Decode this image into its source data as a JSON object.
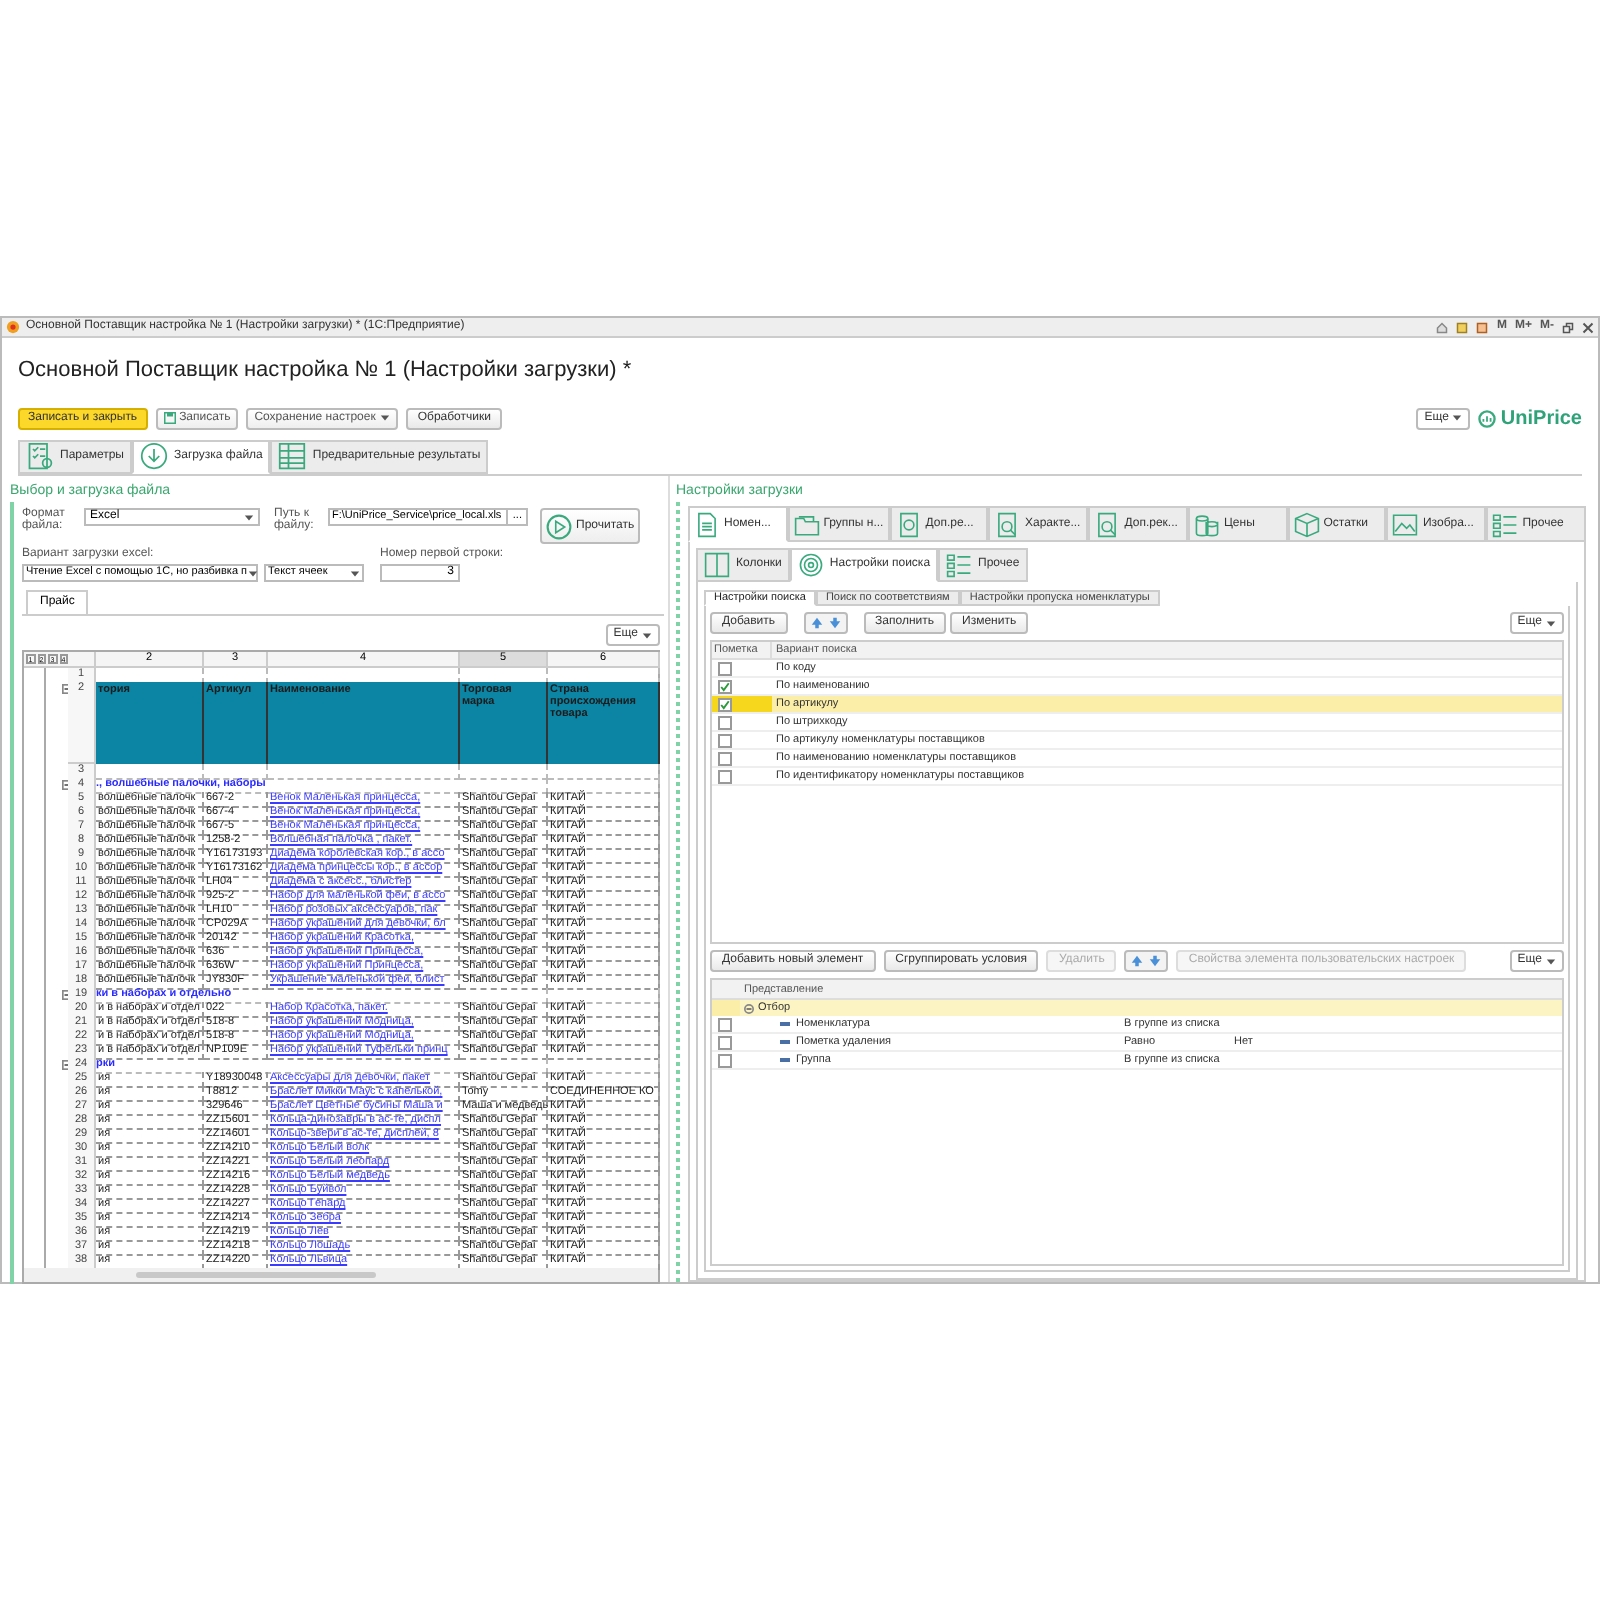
{
  "window": {
    "title": "Основной Поставщик настройка № 1 (Настройки загрузки) * (1С:Предприятие)",
    "memory_buttons": [
      "M",
      "M+",
      "M-"
    ]
  },
  "form": {
    "title": "Основной Поставщик настройка № 1 (Настройки загрузки) *"
  },
  "toolbar": {
    "buttons": [
      {
        "label": "Записать и закрыть",
        "kind": "primary"
      },
      {
        "label": "Записать",
        "kind": "save"
      },
      {
        "label": "Сохранение настроек",
        "kind": "dropdown"
      },
      {
        "label": "Обработчики",
        "kind": "plain"
      }
    ],
    "more": "Еще",
    "logo": "UniPrice"
  },
  "main_tabs": [
    {
      "label": "Параметры",
      "selected": false
    },
    {
      "label": "Загрузка файла",
      "selected": true
    },
    {
      "label": "Предварительные результаты",
      "selected": false
    }
  ],
  "left": {
    "title": "Выбор и загрузка файла",
    "format_label": "Формат файла:",
    "format_value": "Excel",
    "path_label": "Путь к файлу:",
    "path_value": "F:\\UniPrice_Service\\price_local.xls",
    "path_button": "...",
    "read_button": "Прочитать",
    "variant_label": "Вариант загрузки excel:",
    "variant_value": "Чтение Excel с помощью 1С, но разбивка п",
    "text_mode": "Текст ячеек",
    "first_row_label": "Номер первой строки:",
    "first_row_value": "3",
    "sheet_tab": "Прайс",
    "more": "Еще",
    "levels": [
      "1",
      "2",
      "3",
      "4"
    ],
    "columns": [
      {
        "label": "2",
        "selected": false
      },
      {
        "label": "3",
        "selected": false
      },
      {
        "label": "4",
        "selected": false
      },
      {
        "label": "5",
        "selected": true
      },
      {
        "label": "6",
        "selected": false
      }
    ],
    "rows": [
      {
        "n": "1",
        "kind": "empty",
        "cells": []
      },
      {
        "n": "2",
        "kind": "header",
        "cells": [
          "тория",
          "Артикул",
          "Наименование",
          "Торговая марка",
          "Страна происхождения товара"
        ]
      },
      {
        "n": "3",
        "kind": "empty",
        "cells": []
      },
      {
        "n": "4",
        "kind": "group",
        "cells": [
          "., волшебные палочки, наборы"
        ]
      },
      {
        "n": "5",
        "kind": "data",
        "cells": [
          "волшебные палочк",
          "667-2",
          "Венок Маленькая принцесса,",
          "Shantou Gepai",
          "КИТАЙ"
        ]
      },
      {
        "n": "6",
        "kind": "data",
        "cells": [
          "волшебные палочк",
          "667-4",
          "Венок Маленькая принцесса,",
          "Shantou Gepai",
          "КИТАЙ"
        ]
      },
      {
        "n": "7",
        "kind": "data",
        "cells": [
          "волшебные палочк",
          "667-5",
          "Венок Маленькая принцесса,",
          "Shantou Gepai",
          "КИТАЙ"
        ]
      },
      {
        "n": "8",
        "kind": "data",
        "cells": [
          "волшебные палочк",
          "1258-2",
          "Волшебная палочка , пакет.",
          "Shantou Gepai",
          "КИТАЙ"
        ]
      },
      {
        "n": "9",
        "kind": "data",
        "cells": [
          "волшебные палочк",
          "Y16173193",
          "Диадема королевская кор., в ассо",
          "Shantou Gepai",
          "КИТАЙ"
        ]
      },
      {
        "n": "10",
        "kind": "data",
        "cells": [
          "волшебные палочк",
          "Y16173162",
          "Диадема принцессы кор., в ассор",
          "Shantou Gepai",
          "КИТАЙ"
        ]
      },
      {
        "n": "11",
        "kind": "data",
        "cells": [
          "волшебные палочк",
          "LH04",
          "Диадема с аксесс., блистер",
          "Shantou Gepai",
          "КИТАЙ"
        ]
      },
      {
        "n": "12",
        "kind": "data",
        "cells": [
          "волшебные палочк",
          "925-2",
          "Набор для маленькой феи, в ассо",
          "Shantou Gepai",
          "КИТАЙ"
        ]
      },
      {
        "n": "13",
        "kind": "data",
        "cells": [
          "волшебные палочк",
          "LH10",
          "Набор розовых аксессуаров, пак",
          "Shantou Gepai",
          "КИТАЙ"
        ]
      },
      {
        "n": "14",
        "kind": "data",
        "cells": [
          "волшебные палочк",
          "CP029A",
          "Набор украшений для девочки, бл",
          "Shantou Gepai",
          "КИТАЙ"
        ]
      },
      {
        "n": "15",
        "kind": "data",
        "cells": [
          "волшебные палочк",
          "20142",
          "Набор украшений Красотка,",
          "Shantou Gepai",
          "КИТАЙ"
        ]
      },
      {
        "n": "16",
        "kind": "data",
        "cells": [
          "волшебные палочк",
          "636",
          "Набор украшений Принцесса,",
          "Shantou Gepai",
          "КИТАЙ"
        ]
      },
      {
        "n": "17",
        "kind": "data",
        "cells": [
          "волшебные палочк",
          "636W",
          "Набор украшений Принцесса,",
          "Shantou Gepai",
          "КИТАЙ"
        ]
      },
      {
        "n": "18",
        "kind": "data",
        "cells": [
          "волшебные палочк",
          "JY830F",
          "Украшение маленькой феи, блист",
          "Shantou Gepai",
          "КИТАЙ"
        ]
      },
      {
        "n": "19",
        "kind": "group",
        "cells": [
          "ки в наборах и отдельно"
        ]
      },
      {
        "n": "20",
        "kind": "data",
        "cells": [
          "и в наборах и отдел",
          "022",
          "Набор Красотка, пакет.",
          "Shantou Gepai",
          "КИТАЙ"
        ]
      },
      {
        "n": "21",
        "kind": "data",
        "cells": [
          "и в наборах и отдел",
          "518-8",
          "Набор украшений Модница,",
          "Shantou Gepai",
          "КИТАЙ"
        ]
      },
      {
        "n": "22",
        "kind": "data",
        "cells": [
          "и в наборах и отдел",
          "518-8",
          "Набор украшений Модница,",
          "Shantou Gepai",
          "КИТАЙ"
        ]
      },
      {
        "n": "23",
        "kind": "data",
        "cells": [
          "и в наборах и отдел",
          "NP109E",
          "Набор украшений Туфельки принц",
          "Shantou Gepai",
          "КИТАЙ"
        ]
      },
      {
        "n": "24",
        "kind": "group",
        "cells": [
          "рки"
        ]
      },
      {
        "n": "25",
        "kind": "data",
        "cells": [
          "ия",
          "Y18930048",
          "Аксессуары для девочки, пакет",
          "Shantou Gepai",
          "КИТАЙ"
        ]
      },
      {
        "n": "26",
        "kind": "data",
        "cells": [
          "ия",
          "T8812",
          "Браслет Микки Маус с капелькой,",
          "Tomy",
          "СОЕДИНЕННОЕ КО"
        ]
      },
      {
        "n": "27",
        "kind": "data",
        "cells": [
          "ия",
          "329646",
          "Браслет Цветные бусины Маша и",
          "Маша и медведь",
          "КИТАЙ"
        ]
      },
      {
        "n": "28",
        "kind": "data",
        "cells": [
          "ия",
          "ZZ15601",
          "Кольца-динозавры в ас-те, диспл",
          "Shantou Gepai",
          "КИТАЙ"
        ]
      },
      {
        "n": "29",
        "kind": "data",
        "cells": [
          "ия",
          "ZZ14601",
          "Кольцо-звери в ас-те, дисплей, 8",
          "Shantou Gepai",
          "КИТАЙ"
        ]
      },
      {
        "n": "30",
        "kind": "data",
        "cells": [
          "ия",
          "ZZ14210",
          "Кольцо Белый волк",
          "Shantou Gepai",
          "КИТАЙ"
        ]
      },
      {
        "n": "31",
        "kind": "data",
        "cells": [
          "ия",
          "ZZ14221",
          "Кольцо Белый леопард",
          "Shantou Gepai",
          "КИТАЙ"
        ]
      },
      {
        "n": "32",
        "kind": "data",
        "cells": [
          "ия",
          "ZZ14216",
          "Кольцо Белый медведь",
          "Shantou Gepai",
          "КИТАЙ"
        ]
      },
      {
        "n": "33",
        "kind": "data",
        "cells": [
          "ия",
          "ZZ14228",
          "Кольцо Буйвол",
          "Shantou Gepai",
          "КИТАЙ"
        ]
      },
      {
        "n": "34",
        "kind": "data",
        "cells": [
          "ия",
          "ZZ14227",
          "Кольцо Гепард",
          "Shantou Gepai",
          "КИТАЙ"
        ]
      },
      {
        "n": "35",
        "kind": "data",
        "cells": [
          "ия",
          "ZZ14214",
          "Кольцо Зебра",
          "Shantou Gepai",
          "КИТАЙ"
        ]
      },
      {
        "n": "36",
        "kind": "data",
        "cells": [
          "ия",
          "ZZ14219",
          "Кольцо Лев",
          "Shantou Gepai",
          "КИТАЙ"
        ]
      },
      {
        "n": "37",
        "kind": "data",
        "cells": [
          "ия",
          "ZZ14218",
          "Кольцо Лошадь",
          "Shantou Gepai",
          "КИТАЙ"
        ]
      },
      {
        "n": "38",
        "kind": "data",
        "cells": [
          "ия",
          "ZZ14220",
          "Кольцо Львица",
          "Shantou Gepai",
          "КИТАЙ"
        ]
      }
    ]
  },
  "right": {
    "title": "Настройки загрузки",
    "tabs": [
      {
        "label": "Номен...",
        "selected": true
      },
      {
        "label": "Группы н...",
        "selected": false
      },
      {
        "label": "Доп.ре...",
        "selected": false
      },
      {
        "label": "Характе...",
        "selected": false
      },
      {
        "label": "Доп.рек...",
        "selected": false
      },
      {
        "label": "Цены",
        "selected": false
      },
      {
        "label": "Остатки",
        "selected": false
      },
      {
        "label": "Изобра...",
        "selected": false
      },
      {
        "label": "Прочее",
        "selected": false
      }
    ],
    "sub_tabs": [
      {
        "label": "Колонки",
        "selected": false
      },
      {
        "label": "Настройки поиска",
        "selected": true
      },
      {
        "label": "Прочее",
        "selected": false
      }
    ],
    "inner_tabs": [
      {
        "label": "Настройки поиска",
        "selected": true
      },
      {
        "label": "Поиск по соответствиям",
        "selected": false
      },
      {
        "label": "Настройки пропуска номенклатуры",
        "selected": false
      }
    ],
    "search_toolbar": {
      "add": "Добавить",
      "fill": "Заполнить",
      "edit": "Изменить",
      "more": "Еще"
    },
    "search_columns": [
      "Пометка",
      "Вариант поиска"
    ],
    "search_rows": [
      {
        "label": "По коду",
        "checked": false,
        "selected": false
      },
      {
        "label": "По наименованию",
        "checked": true,
        "selected": false
      },
      {
        "label": "По артикулу",
        "checked": true,
        "selected": true
      },
      {
        "label": "По штрихкоду",
        "checked": false,
        "selected": false
      },
      {
        "label": "По артикулу номенклатуры поставщиков",
        "checked": false,
        "selected": false
      },
      {
        "label": "По наименованию номенклатуры поставщиков",
        "checked": false,
        "selected": false
      },
      {
        "label": "По идентификатору номенклатуры поставщиков",
        "checked": false,
        "selected": false
      }
    ],
    "filter_toolbar": [
      {
        "label": "Добавить новый элемент",
        "disabled": false
      },
      {
        "label": "Сгруппировать условия",
        "disabled": false
      },
      {
        "label": "Удалить",
        "disabled": true
      },
      {
        "label": "Свойства элемента пользовательских настроек",
        "disabled": true
      }
    ],
    "filter_more": "Еще",
    "filter_column": "Представление",
    "filter_group": {
      "label": "Отбор",
      "expanded": true,
      "children": [
        {
          "label": "Номенклатура",
          "condition": "В группе из списка",
          "checked": false
        },
        {
          "label": "Пометка удаления",
          "condition": "Равно",
          "value": "Нет",
          "checked": false
        },
        {
          "label": "Группа",
          "condition": "В группе из списка",
          "checked": false
        }
      ]
    }
  }
}
